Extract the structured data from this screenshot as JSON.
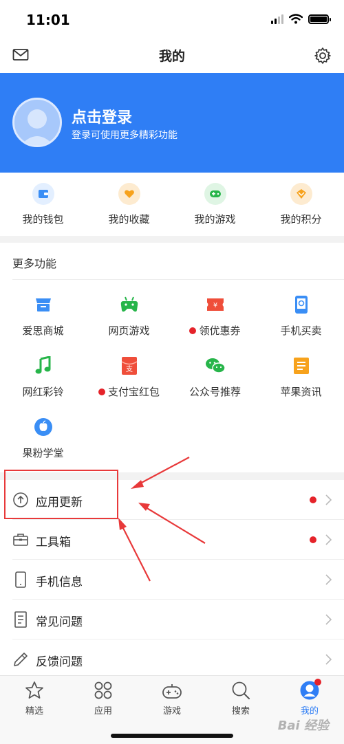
{
  "status_bar": {
    "time": "11:01"
  },
  "nav": {
    "title": "我的",
    "mail_icon": "mail-icon",
    "settings_icon": "gear-icon"
  },
  "banner": {
    "title": "点击登录",
    "subtitle": "登录可使用更多精彩功能",
    "background": "#2f7ef5"
  },
  "quick_actions": [
    {
      "label": "我的钱包",
      "icon": "wallet-icon",
      "color": "#3a8ef5"
    },
    {
      "label": "我的收藏",
      "icon": "heart-icon",
      "color": "#f7a21c"
    },
    {
      "label": "我的游戏",
      "icon": "gamepad-icon",
      "color": "#27b54a"
    },
    {
      "label": "我的积分",
      "icon": "points-icon",
      "color": "#f7a21c"
    }
  ],
  "more_features": {
    "title": "更多功能",
    "items": [
      {
        "label": "爱思商城",
        "icon": "store-icon",
        "badge": false,
        "color": "#3a8ef5"
      },
      {
        "label": "网页游戏",
        "icon": "gamepad-icon",
        "badge": false,
        "color": "#27b54a"
      },
      {
        "label": "领优惠券",
        "icon": "coupon-icon",
        "badge": true,
        "color": "#ef4e3a"
      },
      {
        "label": "手机买卖",
        "icon": "phone-trade-icon",
        "badge": false,
        "color": "#3a8ef5"
      },
      {
        "label": "网红彩铃",
        "icon": "music-note-icon",
        "badge": false,
        "color": "#27b54a"
      },
      {
        "label": "支付宝红包",
        "icon": "red-envelope-icon",
        "badge": true,
        "color": "#ef4e3a"
      },
      {
        "label": "公众号推荐",
        "icon": "wechat-icon",
        "badge": false,
        "color": "#27b54a"
      },
      {
        "label": "苹果资讯",
        "icon": "news-icon",
        "badge": false,
        "color": "#f7a21c"
      },
      {
        "label": "果粉学堂",
        "icon": "apple-icon",
        "badge": false,
        "color": "#3a8ef5"
      }
    ]
  },
  "menu": [
    {
      "label": "应用更新",
      "icon": "update-icon",
      "badge": true
    },
    {
      "label": "工具箱",
      "icon": "toolbox-icon",
      "badge": true
    },
    {
      "label": "手机信息",
      "icon": "phone-icon",
      "badge": false
    },
    {
      "label": "常见问题",
      "icon": "document-icon",
      "badge": false
    },
    {
      "label": "反馈问题",
      "icon": "pencil-icon",
      "badge": false
    }
  ],
  "tabs": [
    {
      "label": "精选",
      "icon": "star-icon",
      "active": false
    },
    {
      "label": "应用",
      "icon": "apps-grid-icon",
      "active": false
    },
    {
      "label": "游戏",
      "icon": "game-controller-icon",
      "active": false
    },
    {
      "label": "搜索",
      "icon": "search-icon",
      "active": false
    },
    {
      "label": "我的",
      "icon": "profile-icon",
      "active": true
    }
  ],
  "accent_color": "#2f7ef5",
  "badge_color": "#e5232a",
  "annotation_color": "#e8393a",
  "watermark": "Bai 经验"
}
